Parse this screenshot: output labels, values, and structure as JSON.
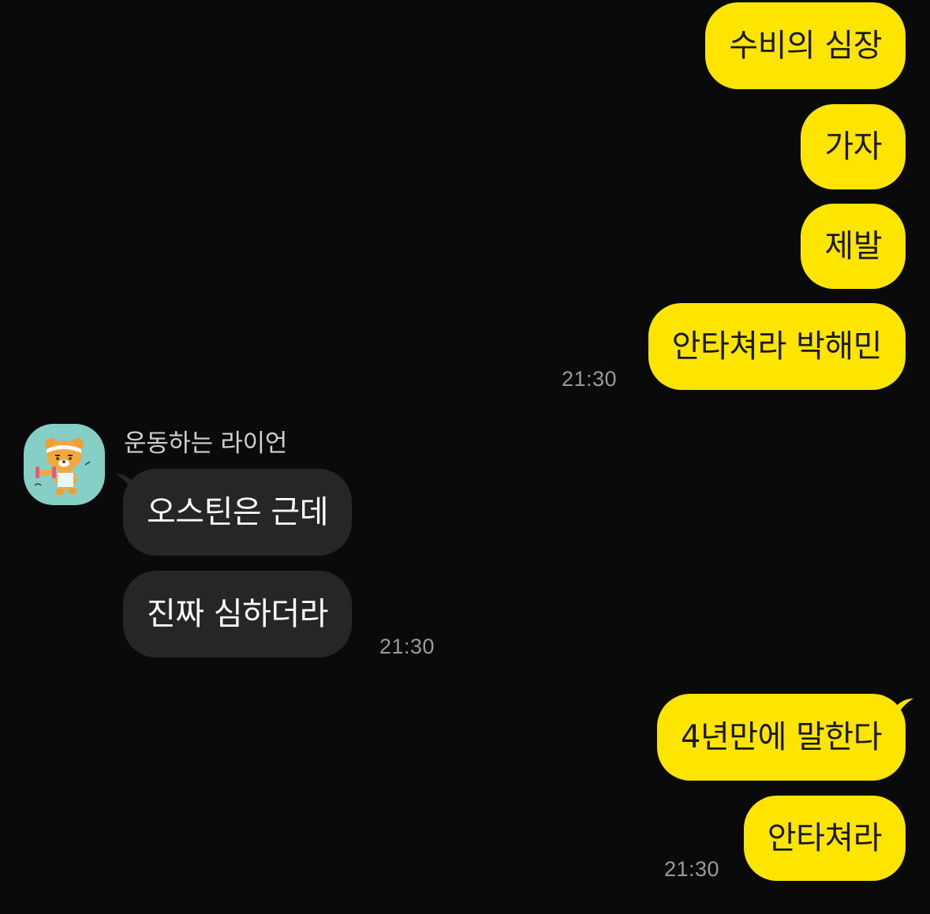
{
  "sender": {
    "name": "운동하는 라이언",
    "avatar_icon": "ryan-exercising-avatar-icon",
    "avatar_bg": "#86cfc6"
  },
  "colors": {
    "outgoing_bubble": "#fee500",
    "incoming_bubble": "#262626",
    "background": "#0a0a0a",
    "timestamp": "#9a9a9a"
  },
  "messages": {
    "group1": [
      {
        "text": "수비의 심장"
      },
      {
        "text": "가자"
      },
      {
        "text": "제발"
      },
      {
        "text": "안타쳐라 박해민"
      }
    ],
    "group1_time": "21:30",
    "group2": [
      {
        "text": "오스틴은 근데"
      },
      {
        "text": "진짜 심하더라"
      }
    ],
    "group2_time": "21:30",
    "group3": [
      {
        "text": "4년만에 말한다"
      },
      {
        "text": "안타쳐라"
      }
    ],
    "group3_time": "21:30"
  }
}
